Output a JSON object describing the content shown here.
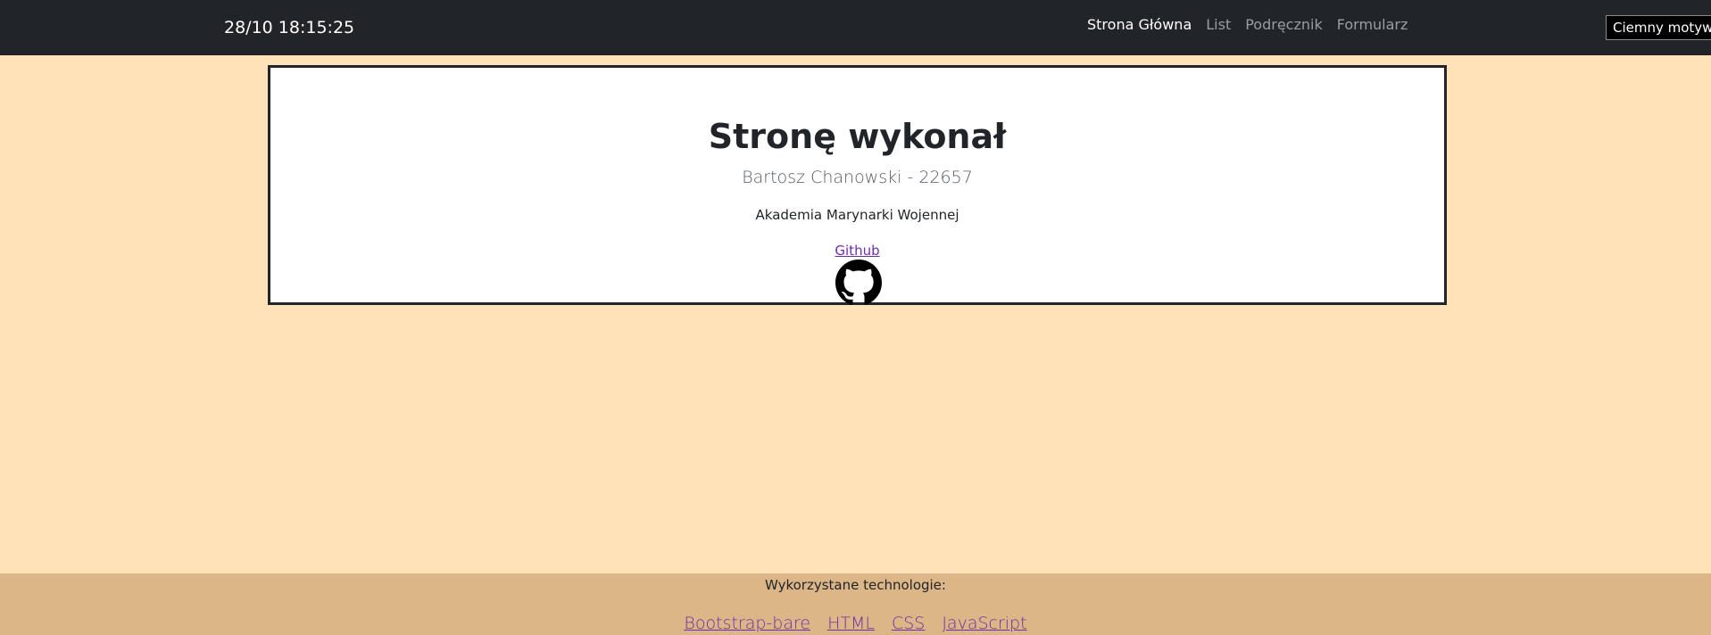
{
  "navbar": {
    "clock": "28/10 18:15:25",
    "links": [
      {
        "label": "Strona Główna",
        "active": true
      },
      {
        "label": "List",
        "active": false
      },
      {
        "label": "Podręcznik",
        "active": false
      },
      {
        "label": "Formularz",
        "active": false
      }
    ],
    "theme_button": "Ciemny motyw"
  },
  "card": {
    "title": "Stronę wykonał",
    "author": "Bartosz Chanowski - 22657",
    "school": "Akademia Marynarki Wojennej",
    "link_label": "Github",
    "icon": "github-icon"
  },
  "footer": {
    "title": "Wykorzystane technologie:",
    "links": [
      "Bootstrap-bare",
      "HTML",
      "CSS",
      "JavaScript"
    ]
  },
  "colors": {
    "page_background": "#ffe2b8",
    "navbar_background": "#212529",
    "footer_background": "#ddb688",
    "link": "#6f2da8"
  }
}
